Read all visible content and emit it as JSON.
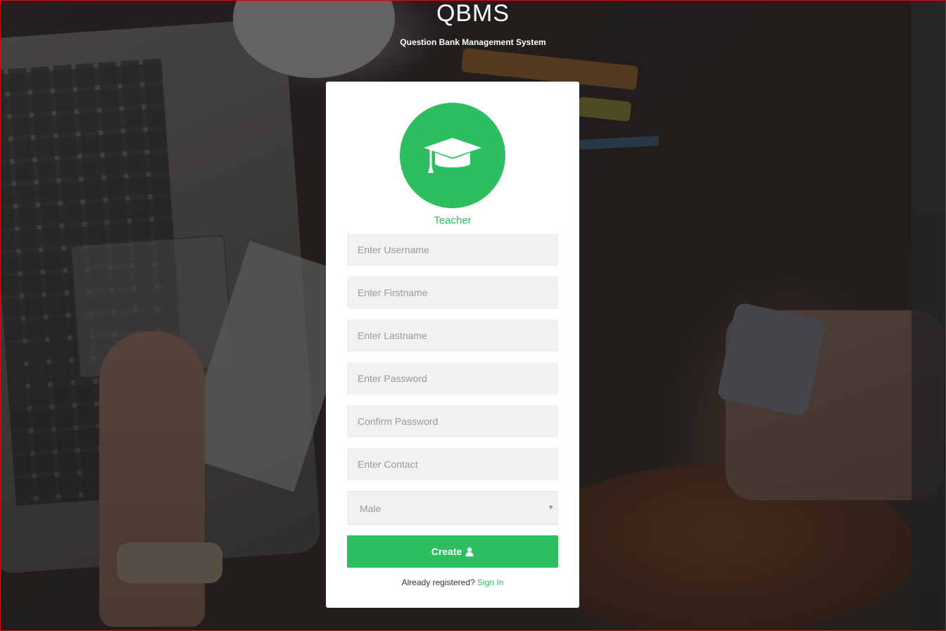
{
  "header": {
    "title": "QBMS",
    "subtitle": "Question Bank Management System"
  },
  "card": {
    "icon": "graduation-cap-icon",
    "role_label": "Teacher",
    "fields": {
      "username_placeholder": "Enter Username",
      "firstname_placeholder": "Enter Firstname",
      "lastname_placeholder": "Enter Lastname",
      "password_placeholder": "Enter Password",
      "confirm_password_placeholder": "Confirm Password",
      "contact_placeholder": "Enter Contact"
    },
    "gender_select": {
      "selected": "Male"
    },
    "create_button_label": "Create",
    "create_button_icon": "user-icon",
    "footer_text": "Already registered?",
    "signin_link_label": "Sign In"
  },
  "colors": {
    "accent": "#2dbe60",
    "field_bg": "#f1f1f1",
    "card_bg": "#ffffff"
  }
}
